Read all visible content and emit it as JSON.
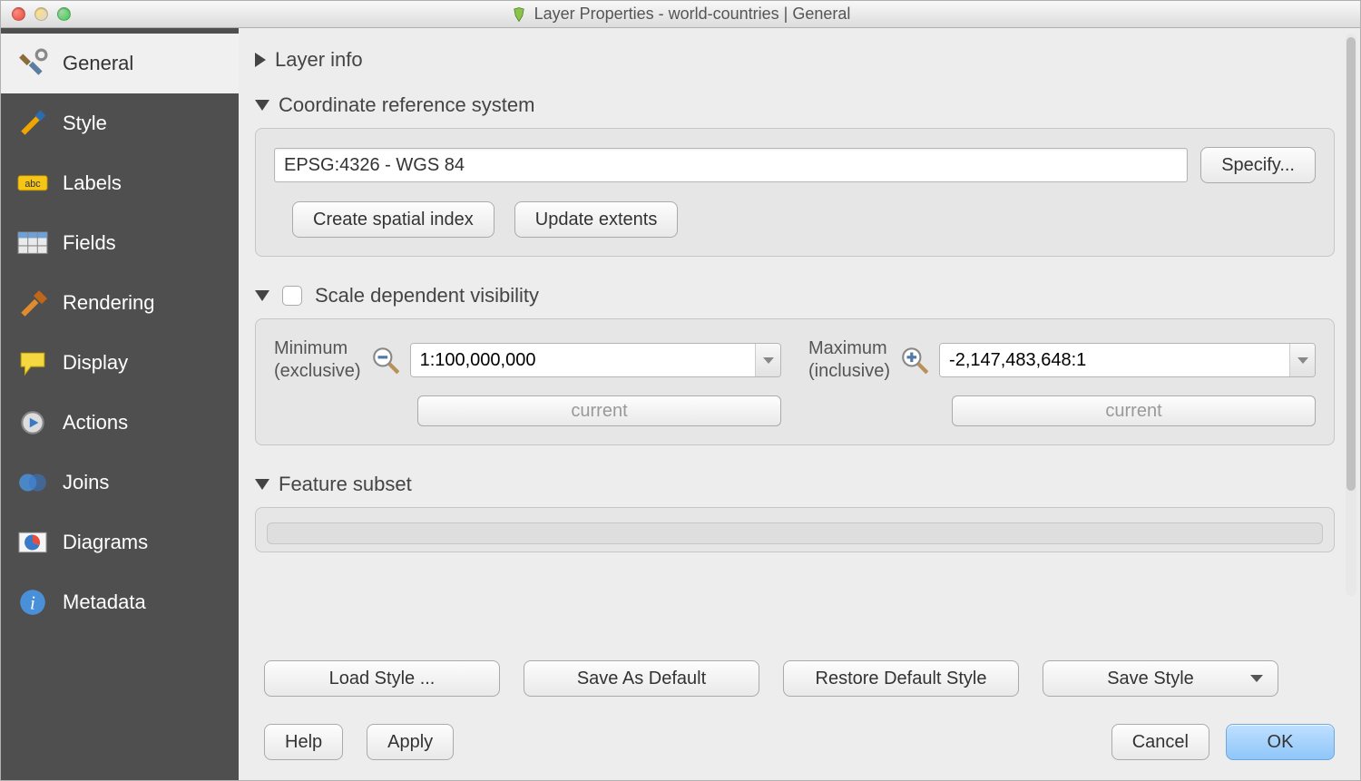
{
  "window": {
    "title": "Layer Properties - world-countries | General"
  },
  "sidebar": {
    "items": [
      {
        "label": "General"
      },
      {
        "label": "Style"
      },
      {
        "label": "Labels"
      },
      {
        "label": "Fields"
      },
      {
        "label": "Rendering"
      },
      {
        "label": "Display"
      },
      {
        "label": "Actions"
      },
      {
        "label": "Joins"
      },
      {
        "label": "Diagrams"
      },
      {
        "label": "Metadata"
      }
    ]
  },
  "sections": {
    "layer_info": {
      "title": "Layer info"
    },
    "crs": {
      "title": "Coordinate reference system",
      "value": "EPSG:4326 - WGS 84",
      "specify_label": "Specify...",
      "create_index_label": "Create spatial index",
      "update_extents_label": "Update extents"
    },
    "scale": {
      "title": "Scale dependent visibility",
      "min_label_line1": "Minimum",
      "min_label_line2": "(exclusive)",
      "min_value": "1:100,000,000",
      "max_label_line1": "Maximum",
      "max_label_line2": "(inclusive)",
      "max_value": "-2,147,483,648:1",
      "current_label": "current"
    },
    "feature_subset": {
      "title": "Feature subset"
    }
  },
  "footer": {
    "load_style": "Load Style ...",
    "save_default": "Save As Default",
    "restore_default": "Restore Default Style",
    "save_style": "Save Style",
    "help": "Help",
    "apply": "Apply",
    "cancel": "Cancel",
    "ok": "OK"
  }
}
